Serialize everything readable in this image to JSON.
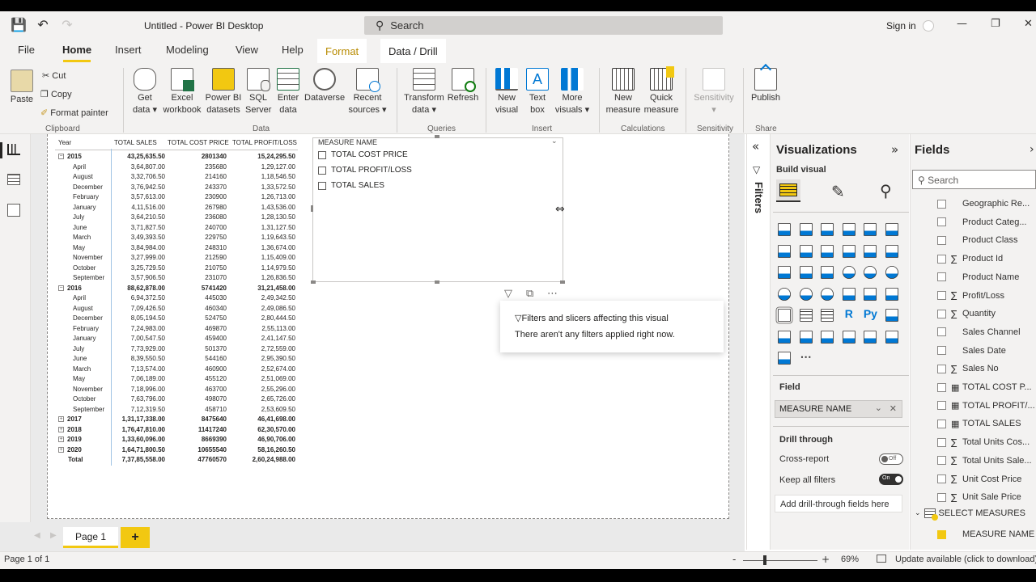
{
  "window": {
    "title": "Untitled - Power BI Desktop",
    "search_placeholder": "Search",
    "sign_in": "Sign in"
  },
  "tabs": {
    "file": "File",
    "home": "Home",
    "insert": "Insert",
    "modeling": "Modeling",
    "view": "View",
    "help": "Help",
    "format": "Format",
    "data_drill": "Data / Drill"
  },
  "ribbon": {
    "paste": "Paste",
    "cut": "Cut",
    "copy": "Copy",
    "format_painter": "Format painter",
    "group_clipboard": "Clipboard",
    "get_data": "Get",
    "get_data2": "data",
    "excel": "Excel",
    "excel2": "workbook",
    "pbi_datasets": "Power BI",
    "pbi_datasets2": "datasets",
    "sql": "SQL",
    "sql2": "Server",
    "enter_data": "Enter",
    "enter_data2": "data",
    "dataverse": "Dataverse",
    "recent": "Recent",
    "recent2": "sources",
    "group_data": "Data",
    "transform": "Transform",
    "transform2": "data",
    "refresh": "Refresh",
    "group_queries": "Queries",
    "new_visual": "New",
    "new_visual2": "visual",
    "text_box": "Text",
    "text_box2": "box",
    "more_visuals": "More",
    "more_visuals2": "visuals",
    "group_insert": "Insert",
    "new_measure": "New",
    "new_measure2": "measure",
    "quick_measure": "Quick",
    "quick_measure2": "measure",
    "group_calc": "Calculations",
    "sensitivity": "Sensitivity",
    "group_sensitivity": "Sensitivity",
    "publish": "Publish",
    "group_share": "Share"
  },
  "matrix": {
    "headers": [
      "Year",
      "TOTAL SALES",
      "TOTAL COST PRICE",
      "TOTAL PROFIT/LOSS"
    ],
    "rows": [
      {
        "label": "2015",
        "level": "year",
        "expanded": true,
        "sales": "43,25,635.50",
        "cost": "2801340",
        "profit": "15,24,295.50"
      },
      {
        "label": "April",
        "level": "month",
        "sales": "3,64,807.00",
        "cost": "235680",
        "profit": "1,29,127.00"
      },
      {
        "label": "August",
        "level": "month",
        "sales": "3,32,706.50",
        "cost": "214160",
        "profit": "1,18,546.50"
      },
      {
        "label": "December",
        "level": "month",
        "sales": "3,76,942.50",
        "cost": "243370",
        "profit": "1,33,572.50"
      },
      {
        "label": "February",
        "level": "month",
        "sales": "3,57,613.00",
        "cost": "230900",
        "profit": "1,26,713.00"
      },
      {
        "label": "January",
        "level": "month",
        "sales": "4,11,516.00",
        "cost": "267980",
        "profit": "1,43,536.00"
      },
      {
        "label": "July",
        "level": "month",
        "sales": "3,64,210.50",
        "cost": "236080",
        "profit": "1,28,130.50"
      },
      {
        "label": "June",
        "level": "month",
        "sales": "3,71,827.50",
        "cost": "240700",
        "profit": "1,31,127.50"
      },
      {
        "label": "March",
        "level": "month",
        "sales": "3,49,393.50",
        "cost": "229750",
        "profit": "1,19,643.50"
      },
      {
        "label": "May",
        "level": "month",
        "sales": "3,84,984.00",
        "cost": "248310",
        "profit": "1,36,674.00"
      },
      {
        "label": "November",
        "level": "month",
        "sales": "3,27,999.00",
        "cost": "212590",
        "profit": "1,15,409.00"
      },
      {
        "label": "October",
        "level": "month",
        "sales": "3,25,729.50",
        "cost": "210750",
        "profit": "1,14,979.50"
      },
      {
        "label": "September",
        "level": "month",
        "sales": "3,57,906.50",
        "cost": "231070",
        "profit": "1,26,836.50"
      },
      {
        "label": "2016",
        "level": "year",
        "expanded": true,
        "sales": "88,62,878.00",
        "cost": "5741420",
        "profit": "31,21,458.00"
      },
      {
        "label": "April",
        "level": "month",
        "sales": "6,94,372.50",
        "cost": "445030",
        "profit": "2,49,342.50"
      },
      {
        "label": "August",
        "level": "month",
        "sales": "7,09,426.50",
        "cost": "460340",
        "profit": "2,49,086.50"
      },
      {
        "label": "December",
        "level": "month",
        "sales": "8,05,194.50",
        "cost": "524750",
        "profit": "2,80,444.50"
      },
      {
        "label": "February",
        "level": "month",
        "sales": "7,24,983.00",
        "cost": "469870",
        "profit": "2,55,113.00"
      },
      {
        "label": "January",
        "level": "month",
        "sales": "7,00,547.50",
        "cost": "459400",
        "profit": "2,41,147.50"
      },
      {
        "label": "July",
        "level": "month",
        "sales": "7,73,929.00",
        "cost": "501370",
        "profit": "2,72,559.00"
      },
      {
        "label": "June",
        "level": "month",
        "sales": "8,39,550.50",
        "cost": "544160",
        "profit": "2,95,390.50"
      },
      {
        "label": "March",
        "level": "month",
        "sales": "7,13,574.00",
        "cost": "460900",
        "profit": "2,52,674.00"
      },
      {
        "label": "May",
        "level": "month",
        "sales": "7,06,189.00",
        "cost": "455120",
        "profit": "2,51,069.00"
      },
      {
        "label": "November",
        "level": "month",
        "sales": "7,18,996.00",
        "cost": "463700",
        "profit": "2,55,296.00"
      },
      {
        "label": "October",
        "level": "month",
        "sales": "7,63,796.00",
        "cost": "498070",
        "profit": "2,65,726.00"
      },
      {
        "label": "September",
        "level": "month",
        "sales": "7,12,319.50",
        "cost": "458710",
        "profit": "2,53,609.50"
      },
      {
        "label": "2017",
        "level": "year",
        "expanded": false,
        "sales": "1,31,17,338.00",
        "cost": "8475640",
        "profit": "46,41,698.00"
      },
      {
        "label": "2018",
        "level": "year",
        "expanded": false,
        "sales": "1,76,47,810.00",
        "cost": "11417240",
        "profit": "62,30,570.00"
      },
      {
        "label": "2019",
        "level": "year",
        "expanded": false,
        "sales": "1,33,60,096.00",
        "cost": "8669390",
        "profit": "46,90,706.00"
      },
      {
        "label": "2020",
        "level": "year",
        "expanded": false,
        "sales": "1,64,71,800.50",
        "cost": "10655540",
        "profit": "58,16,260.50"
      },
      {
        "label": "Total",
        "level": "total",
        "sales": "7,37,85,558.00",
        "cost": "47760570",
        "profit": "2,60,24,988.00"
      }
    ]
  },
  "slicer": {
    "title": "MEASURE NAME",
    "items": [
      "TOTAL COST PRICE",
      "TOTAL PROFIT/LOSS",
      "TOTAL SALES"
    ]
  },
  "tooltip": {
    "line1": "Filters and slicers affecting this visual",
    "line2": "There aren't any filters applied right now."
  },
  "filters_pane": {
    "label": "Filters"
  },
  "visualizations": {
    "title": "Visualizations",
    "build_visual": "Build visual",
    "field_label": "Field",
    "field_value": "MEASURE NAME",
    "drill_through": "Drill through",
    "cross_report": "Cross-report",
    "cross_report_state": "Off",
    "keep_all_filters": "Keep all filters",
    "keep_all_filters_state": "On",
    "add_drill": "Add drill-through fields here"
  },
  "fields": {
    "title": "Fields",
    "search_placeholder": "Search",
    "items": [
      {
        "label": "Geographic Re...",
        "kind": "text"
      },
      {
        "label": "Product Categ...",
        "kind": "text"
      },
      {
        "label": "Product Class",
        "kind": "text"
      },
      {
        "label": "Product Id",
        "kind": "sum"
      },
      {
        "label": "Product Name",
        "kind": "text"
      },
      {
        "label": "Profit/Loss",
        "kind": "sum"
      },
      {
        "label": "Quantity",
        "kind": "sum"
      },
      {
        "label": "Sales Channel",
        "kind": "text"
      },
      {
        "label": "Sales Date",
        "kind": "text"
      },
      {
        "label": "Sales No",
        "kind": "sum"
      },
      {
        "label": "TOTAL COST P...",
        "kind": "calc"
      },
      {
        "label": "TOTAL PROFIT/...",
        "kind": "calc"
      },
      {
        "label": "TOTAL SALES",
        "kind": "calc"
      },
      {
        "label": "Total Units Cos...",
        "kind": "sum"
      },
      {
        "label": "Total Units Sale...",
        "kind": "sum"
      },
      {
        "label": "Unit Cost Price",
        "kind": "sum"
      },
      {
        "label": "Unit Sale Price",
        "kind": "sum"
      }
    ],
    "table_name": "SELECT MEASURES",
    "table_field": "MEASURE NAME"
  },
  "bottom": {
    "page_tab": "Page 1",
    "add_page": "+",
    "page_count": "Page 1 of 1",
    "zoom": "69%",
    "update": "Update available (click to download)"
  },
  "colors": {
    "accent": "#f2c811",
    "ribbon_bg": "#f3f2f1",
    "canvas_bg": "#eaeaea"
  }
}
